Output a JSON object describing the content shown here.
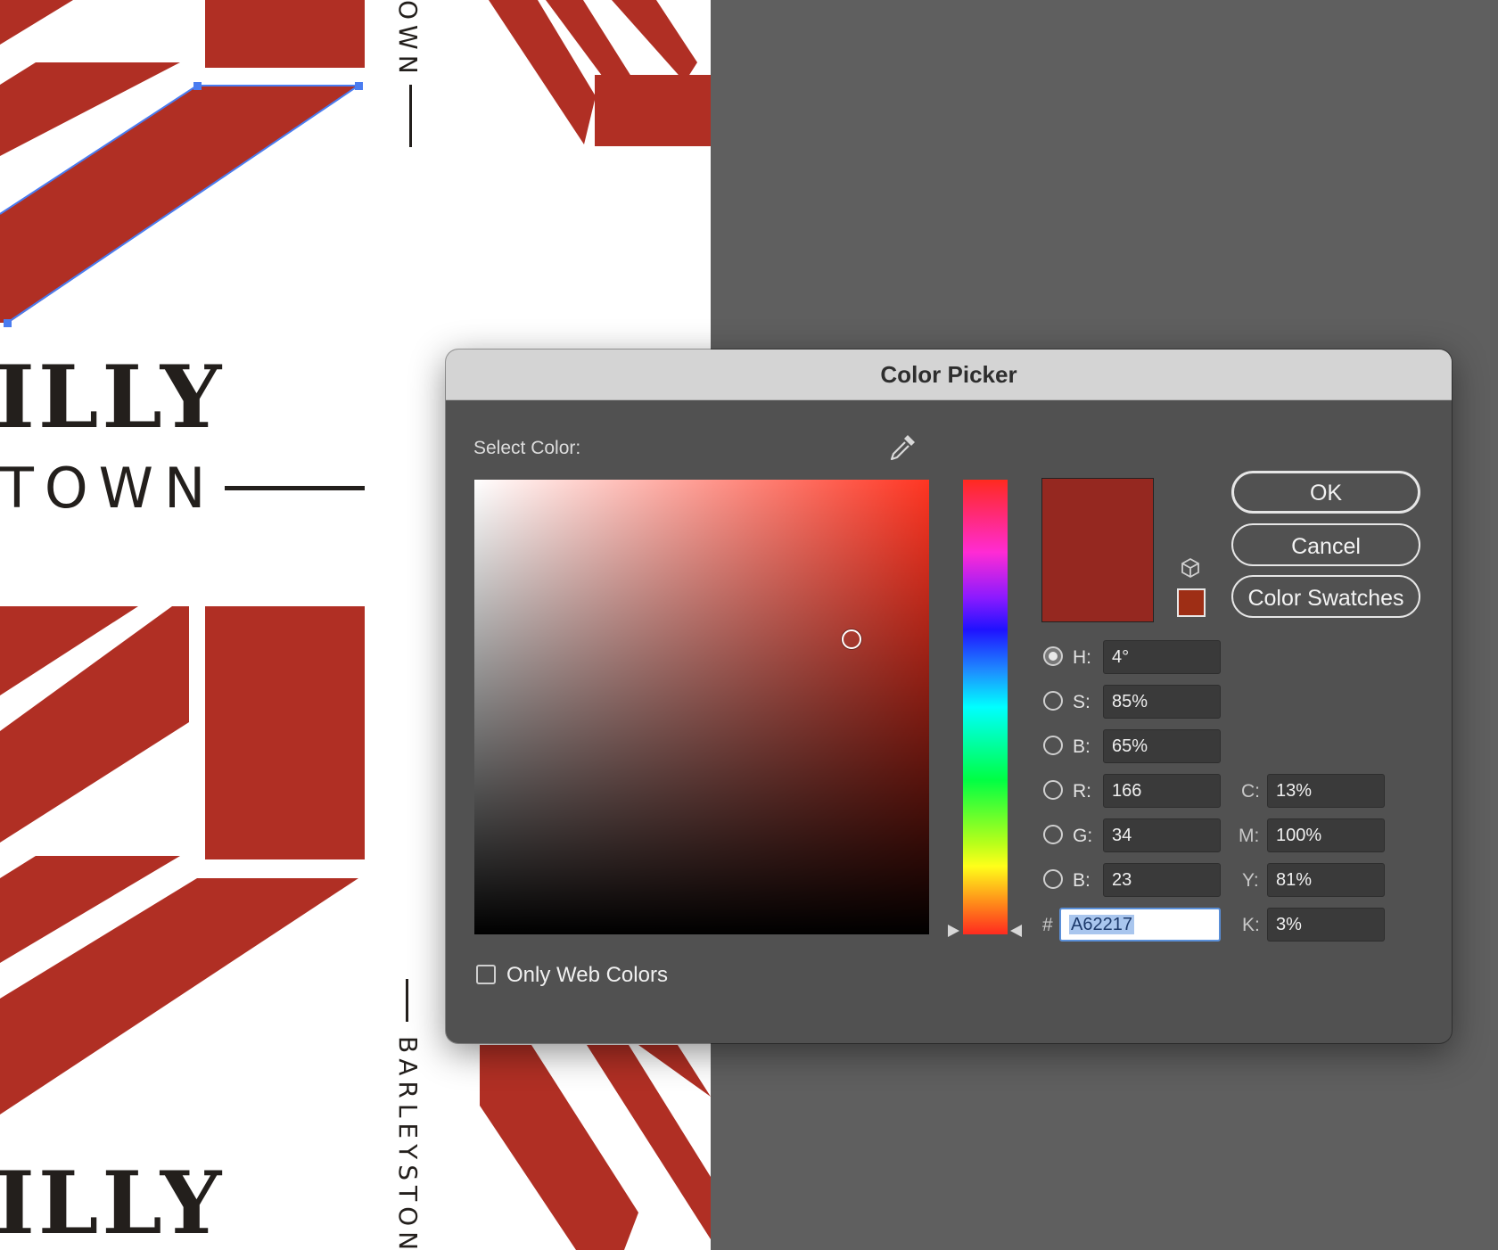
{
  "canvas": {
    "artboard_texts": {
      "wordmark_top": "ILLY",
      "town_label": "TOWN",
      "wordmark_bottom": "ILLY",
      "vertical_top": "OWN",
      "vertical_bottom": "BARLEYSTONE"
    },
    "brand_red": "#B02F24",
    "ink": "#231F1C",
    "selection_color": "#4A7CF0"
  },
  "dialog": {
    "title": "Color Picker",
    "select_color_label": "Select Color:",
    "eyedropper_icon": "eyedropper-icon",
    "out_of_gamut_icon": "cube-icon",
    "new_color": "#952820",
    "web_safe_color": "#9E2E15",
    "buttons": {
      "ok": "OK",
      "cancel": "Cancel",
      "swatches": "Color Swatches"
    },
    "hsb": [
      {
        "label": "H:",
        "value": "4°",
        "selected": true
      },
      {
        "label": "S:",
        "value": "85%",
        "selected": false
      },
      {
        "label": "B:",
        "value": "65%",
        "selected": false
      }
    ],
    "rgb": [
      {
        "label": "R:",
        "value": "166",
        "selected": false
      },
      {
        "label": "G:",
        "value": "34",
        "selected": false
      },
      {
        "label": "B:",
        "value": "23",
        "selected": false
      }
    ],
    "cmyk": [
      {
        "label": "C:",
        "value": "13%"
      },
      {
        "label": "M:",
        "value": "100%"
      },
      {
        "label": "Y:",
        "value": "81%"
      },
      {
        "label": "K:",
        "value": "3%"
      }
    ],
    "hex_label": "#",
    "hex_value": "A62217",
    "web_colors_label": "Only Web Colors",
    "web_colors_checked": false
  }
}
